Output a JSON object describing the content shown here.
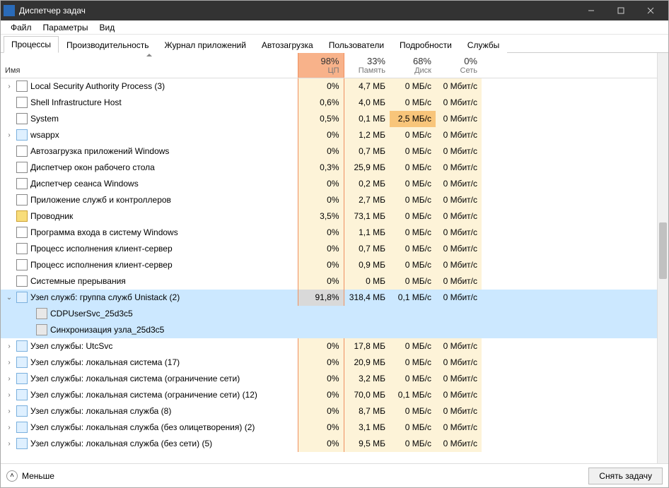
{
  "window": {
    "title": "Диспетчер задач"
  },
  "menu": [
    "Файл",
    "Параметры",
    "Вид"
  ],
  "tabs": [
    "Процессы",
    "Производительность",
    "Журнал приложений",
    "Автозагрузка",
    "Пользователи",
    "Подробности",
    "Службы"
  ],
  "activeTab": 0,
  "columns": {
    "name": "Имя",
    "cpu": {
      "pct": "98%",
      "label": "ЦП"
    },
    "mem": {
      "pct": "33%",
      "label": "Память"
    },
    "disk": {
      "pct": "68%",
      "label": "Диск"
    },
    "net": {
      "pct": "0%",
      "label": "Сеть"
    }
  },
  "rows": [
    {
      "exp": "›",
      "icon": "sys",
      "name": "Local Security Authority Process (3)",
      "cpu": "0%",
      "mem": "4,7 МБ",
      "disk": "0 МБ/с",
      "net": "0 Мбит/с"
    },
    {
      "exp": "",
      "icon": "sys",
      "name": "Shell Infrastructure Host",
      "cpu": "0,6%",
      "mem": "4,0 МБ",
      "disk": "0 МБ/с",
      "net": "0 Мбит/с"
    },
    {
      "exp": "",
      "icon": "sys",
      "name": "System",
      "cpu": "0,5%",
      "mem": "0,1 МБ",
      "disk": "2,5 МБ/с",
      "net": "0 Мбит/с",
      "diskHot": true
    },
    {
      "exp": "›",
      "icon": "svc",
      "name": "wsappx",
      "cpu": "0%",
      "mem": "1,2 МБ",
      "disk": "0 МБ/с",
      "net": "0 Мбит/с"
    },
    {
      "exp": "",
      "icon": "sys",
      "name": "Автозагрузка приложений Windows",
      "cpu": "0%",
      "mem": "0,7 МБ",
      "disk": "0 МБ/с",
      "net": "0 Мбит/с"
    },
    {
      "exp": "",
      "icon": "sys",
      "name": "Диспетчер окон рабочего стола",
      "cpu": "0,3%",
      "mem": "25,9 МБ",
      "disk": "0 МБ/с",
      "net": "0 Мбит/с"
    },
    {
      "exp": "",
      "icon": "sys",
      "name": "Диспетчер сеанса  Windows",
      "cpu": "0%",
      "mem": "0,2 МБ",
      "disk": "0 МБ/с",
      "net": "0 Мбит/с"
    },
    {
      "exp": "",
      "icon": "sys",
      "name": "Приложение служб и контроллеров",
      "cpu": "0%",
      "mem": "2,7 МБ",
      "disk": "0 МБ/с",
      "net": "0 Мбит/с"
    },
    {
      "exp": "",
      "icon": "exp",
      "name": "Проводник",
      "cpu": "3,5%",
      "mem": "73,1 МБ",
      "disk": "0 МБ/с",
      "net": "0 Мбит/с"
    },
    {
      "exp": "",
      "icon": "sys",
      "name": "Программа входа в систему Windows",
      "cpu": "0%",
      "mem": "1,1 МБ",
      "disk": "0 МБ/с",
      "net": "0 Мбит/с"
    },
    {
      "exp": "",
      "icon": "sys",
      "name": "Процесс исполнения клиент-сервер",
      "cpu": "0%",
      "mem": "0,7 МБ",
      "disk": "0 МБ/с",
      "net": "0 Мбит/с"
    },
    {
      "exp": "",
      "icon": "sys",
      "name": "Процесс исполнения клиент-сервер",
      "cpu": "0%",
      "mem": "0,9 МБ",
      "disk": "0 МБ/с",
      "net": "0 Мбит/с"
    },
    {
      "exp": "",
      "icon": "sys",
      "name": "Системные прерывания",
      "cpu": "0%",
      "mem": "0 МБ",
      "disk": "0 МБ/с",
      "net": "0 Мбит/с"
    },
    {
      "exp": "⌄",
      "icon": "svc",
      "name": "Узел служб: группа служб Unistack (2)",
      "cpu": "91,8%",
      "mem": "318,4 МБ",
      "disk": "0,1 МБ/с",
      "net": "0 Мбит/с",
      "selected": true,
      "children": [
        {
          "icon": "gear",
          "name": "CDPUserSvc_25d3c5"
        },
        {
          "icon": "gear",
          "name": "Синхронизация узла_25d3c5"
        }
      ]
    },
    {
      "exp": "›",
      "icon": "svc",
      "name": "Узел службы: UtcSvc",
      "cpu": "0%",
      "mem": "17,8 МБ",
      "disk": "0 МБ/с",
      "net": "0 Мбит/с"
    },
    {
      "exp": "›",
      "icon": "svc",
      "name": "Узел службы: локальная система (17)",
      "cpu": "0%",
      "mem": "20,9 МБ",
      "disk": "0 МБ/с",
      "net": "0 Мбит/с"
    },
    {
      "exp": "›",
      "icon": "svc",
      "name": "Узел службы: локальная система (ограничение сети)",
      "cpu": "0%",
      "mem": "3,2 МБ",
      "disk": "0 МБ/с",
      "net": "0 Мбит/с"
    },
    {
      "exp": "›",
      "icon": "svc",
      "name": "Узел службы: локальная система (ограничение сети) (12)",
      "cpu": "0%",
      "mem": "70,0 МБ",
      "disk": "0,1 МБ/с",
      "net": "0 Мбит/с"
    },
    {
      "exp": "›",
      "icon": "svc",
      "name": "Узел службы: локальная служба (8)",
      "cpu": "0%",
      "mem": "8,7 МБ",
      "disk": "0 МБ/с",
      "net": "0 Мбит/с"
    },
    {
      "exp": "›",
      "icon": "svc",
      "name": "Узел службы: локальная служба (без олицетворения) (2)",
      "cpu": "0%",
      "mem": "3,1 МБ",
      "disk": "0 МБ/с",
      "net": "0 Мбит/с"
    },
    {
      "exp": "›",
      "icon": "svc",
      "name": "Узел службы: локальная служба (без сети) (5)",
      "cpu": "0%",
      "mem": "9,5 МБ",
      "disk": "0 МБ/с",
      "net": "0 Мбит/с"
    }
  ],
  "footer": {
    "fewer": "Меньше",
    "endTask": "Снять задачу"
  }
}
